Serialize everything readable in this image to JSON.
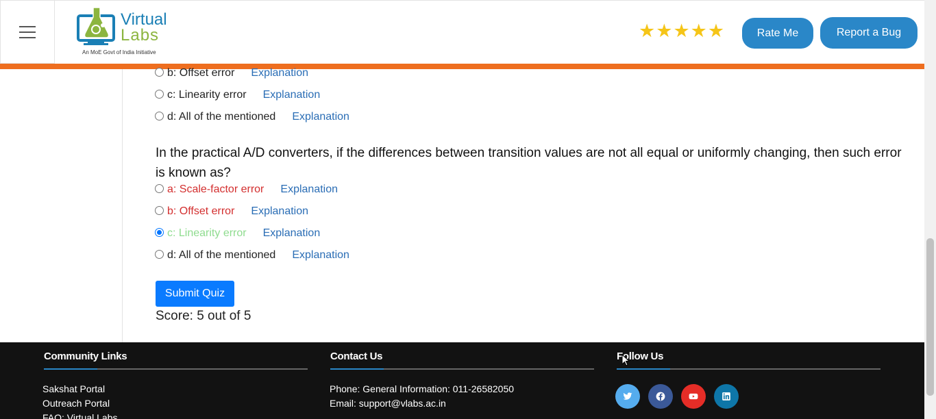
{
  "header": {
    "logo_word1": "Virtual",
    "logo_word2": "Labs",
    "logo_tagline": "An MoE Govt of India Initiative",
    "rating_stars": 5,
    "rate_button": "Rate Me",
    "bug_button": "Report a Bug"
  },
  "quiz": {
    "prev_options": [
      {
        "label": "b: Offset error",
        "explanation": "Explanation"
      },
      {
        "label": "c: Linearity error",
        "explanation": "Explanation"
      },
      {
        "label": "d: All of the mentioned",
        "explanation": "Explanation"
      }
    ],
    "question": "In the practical A/D converters, if the differences between transition values are not all equal or uniformly changing, then such error is known as?",
    "options": [
      {
        "label": "a: Scale-factor error",
        "explanation": "Explanation",
        "state": "wrong"
      },
      {
        "label": "b: Offset error",
        "explanation": "Explanation",
        "state": "wrong"
      },
      {
        "label": "c: Linearity error",
        "explanation": "Explanation",
        "state": "correct-selected"
      },
      {
        "label": "d: All of the mentioned",
        "explanation": "Explanation",
        "state": "normal"
      }
    ],
    "submit_label": "Submit Quiz",
    "score_text": "Score: 5 out of 5"
  },
  "footer": {
    "community": {
      "title": "Community Links",
      "links": [
        "Sakshat Portal",
        "Outreach Portal",
        "FAQ: Virtual Labs"
      ]
    },
    "contact": {
      "title": "Contact Us",
      "phone": "Phone: General Information: 011-26582050",
      "email": "Email: support@vlabs.ac.in"
    },
    "follow": {
      "title": "Follow Us",
      "icons": [
        "twitter-icon",
        "facebook-icon",
        "youtube-icon",
        "linkedin-icon"
      ]
    }
  },
  "colors": {
    "accent_blue": "#2a87c8",
    "orange_bar": "#ee6e1f",
    "submit_blue": "#0a7bff",
    "wrong_red": "#d32f2f",
    "correct_green": "#8fdc8f",
    "explanation_link": "#2a6db5",
    "footer_bg": "#121212"
  }
}
